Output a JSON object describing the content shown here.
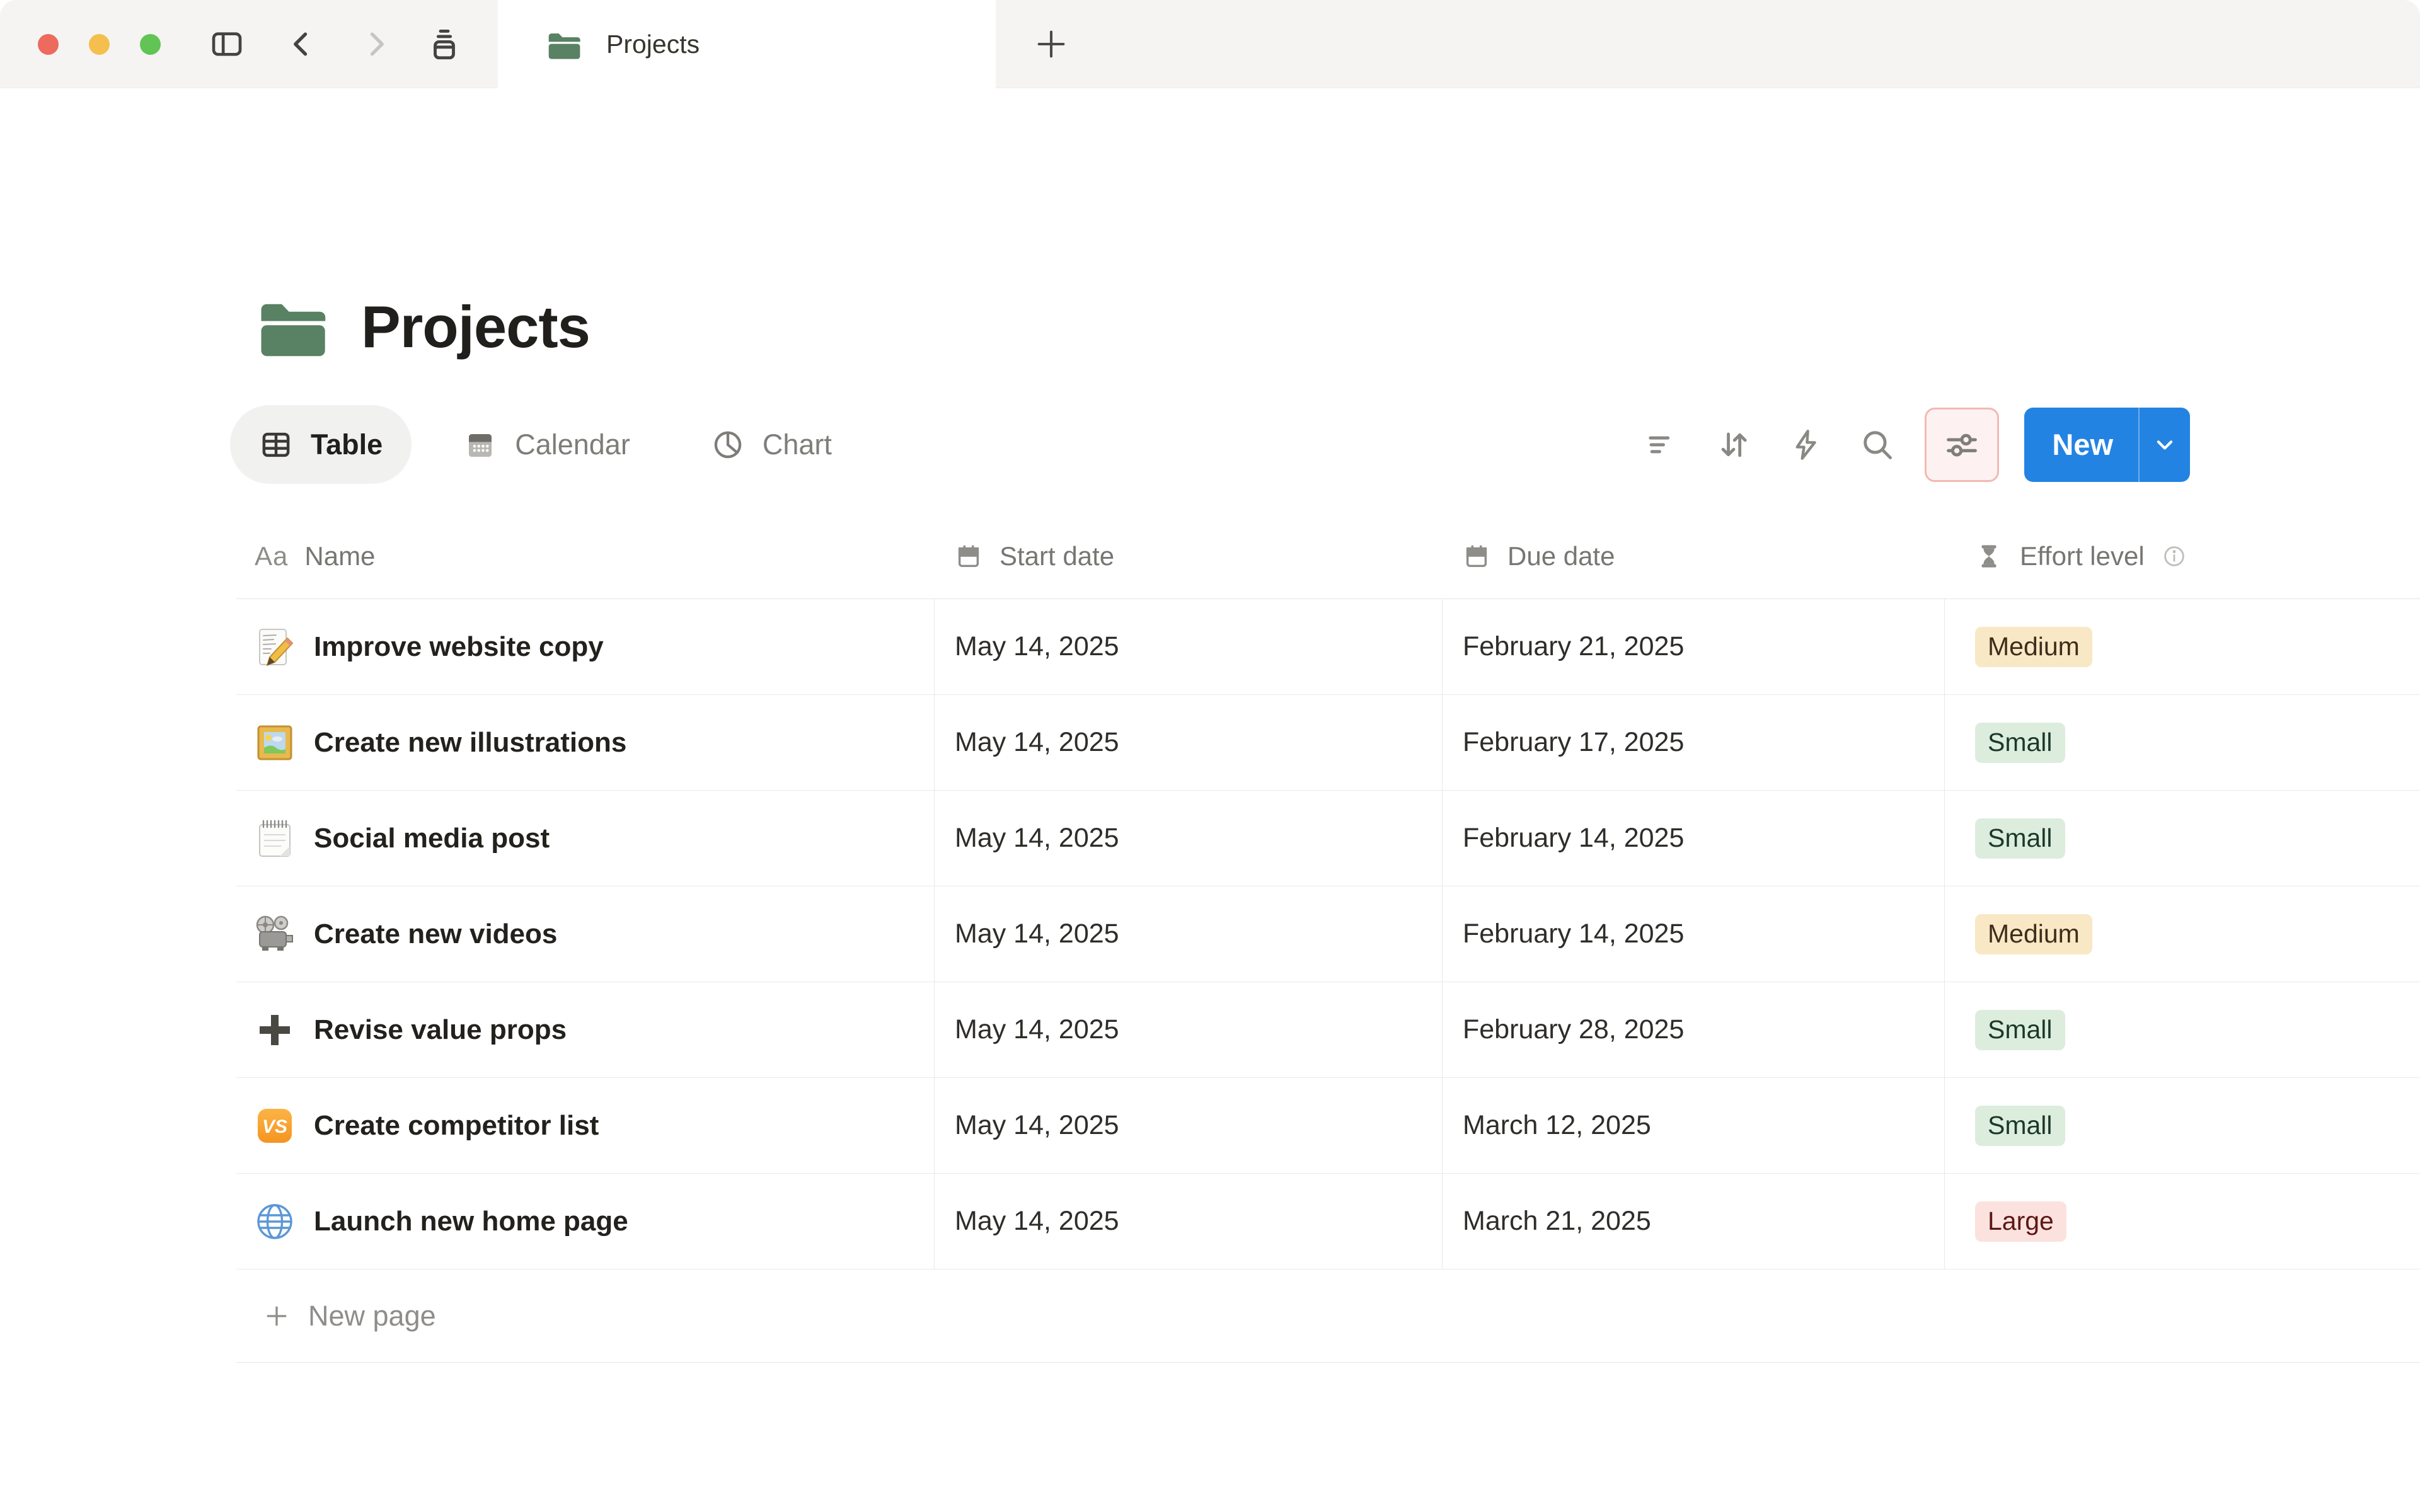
{
  "window": {
    "controls": [
      "close",
      "minimize",
      "fullscreen"
    ],
    "tab": {
      "title": "Projects",
      "icon": "green-folder-icon"
    },
    "nav_icons": [
      "sidebar-toggle-icon",
      "back-chevron-icon",
      "forward-chevron-icon",
      "history-icon",
      "new-tab-plus-icon"
    ]
  },
  "page": {
    "title": "Projects",
    "icon": "green-folder-icon"
  },
  "viewbar": {
    "views": [
      {
        "label": "Table",
        "icon": "table-icon",
        "active": true
      },
      {
        "label": "Calendar",
        "icon": "calendar-icon",
        "active": false
      },
      {
        "label": "Chart",
        "icon": "pie-chart-icon",
        "active": false
      }
    ],
    "action_icons": [
      "filter-icon",
      "sort-icon",
      "lightning-icon",
      "search-icon",
      "sliders-icon"
    ],
    "settings_highlighted": true,
    "new_button": {
      "label": "New",
      "has_dropdown": true
    }
  },
  "table": {
    "columns": [
      {
        "label": "Name",
        "icon": "text-aa-icon"
      },
      {
        "label": "Start date",
        "icon": "calendar-icon"
      },
      {
        "label": "Due date",
        "icon": "calendar-icon"
      },
      {
        "label": "Effort level",
        "icon": "hourglass-icon",
        "info_icon": true
      }
    ],
    "rows": [
      {
        "icon": "memo-emoji",
        "name": "Improve website copy",
        "start": "May 14, 2025",
        "due": "February 21, 2025",
        "effort": "Medium",
        "effort_color": "yellow"
      },
      {
        "icon": "framed-picture-emoji",
        "name": "Create new illustrations",
        "start": "May 14, 2025",
        "due": "February 17, 2025",
        "effort": "Small",
        "effort_color": "green"
      },
      {
        "icon": "spiral-notepad-emoji",
        "name": "Social media post",
        "start": "May 14, 2025",
        "due": "February 14, 2025",
        "effort": "Small",
        "effort_color": "green"
      },
      {
        "icon": "movie-camera-emoji",
        "name": "Create new videos",
        "start": "May 14, 2025",
        "due": "February 14, 2025",
        "effort": "Medium",
        "effort_color": "yellow"
      },
      {
        "icon": "plus-emoji",
        "name": "Revise value props",
        "start": "May 14, 2025",
        "due": "February 28, 2025",
        "effort": "Small",
        "effort_color": "green"
      },
      {
        "icon": "vs-button-emoji",
        "name": "Create competitor list",
        "start": "May 14, 2025",
        "due": "March 12, 2025",
        "effort": "Small",
        "effort_color": "green"
      },
      {
        "icon": "globe-emoji",
        "name": "Launch new home page",
        "start": "May 14, 2025",
        "due": "March 21, 2025",
        "effort": "Large",
        "effort_color": "red"
      }
    ],
    "new_page_label": "New page"
  },
  "colors": {
    "accent_blue": "#2383e2",
    "folder_green": "#598164",
    "badge_yellow_bg": "#f9e8c5",
    "badge_yellow_text": "#402c1b",
    "badge_green_bg": "#dcedde",
    "badge_green_text": "#1c3829",
    "badge_red_bg": "#fbe2de",
    "badge_red_text": "#5d1715",
    "settings_highlight_border": "#f2b9b3",
    "settings_highlight_bg": "#fdf2f1",
    "titlebar_bg": "#f5f4f2"
  }
}
